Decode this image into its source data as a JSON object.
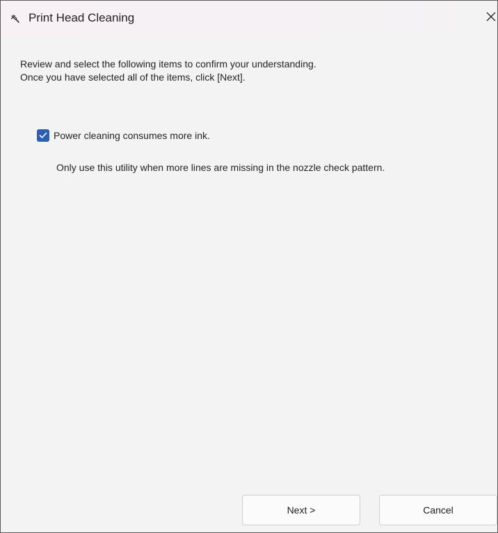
{
  "window": {
    "title": "Print Head Cleaning",
    "app_icon": "brush-icon",
    "close_icon": "close-icon"
  },
  "intro": {
    "line1": "Review and select the following items to confirm your understanding.",
    "line2": "Once you have selected all of the items, click [Next]."
  },
  "confirm_item": {
    "label": "Power cleaning consumes more ink.",
    "checked": true,
    "note": "Only use this utility when more lines are missing in the nozzle check pattern."
  },
  "buttons": {
    "next_label": "Next >",
    "cancel_label": "Cancel"
  },
  "colors": {
    "checkbox_accent": "#2d5fb1",
    "background": "#f3f3f3"
  }
}
